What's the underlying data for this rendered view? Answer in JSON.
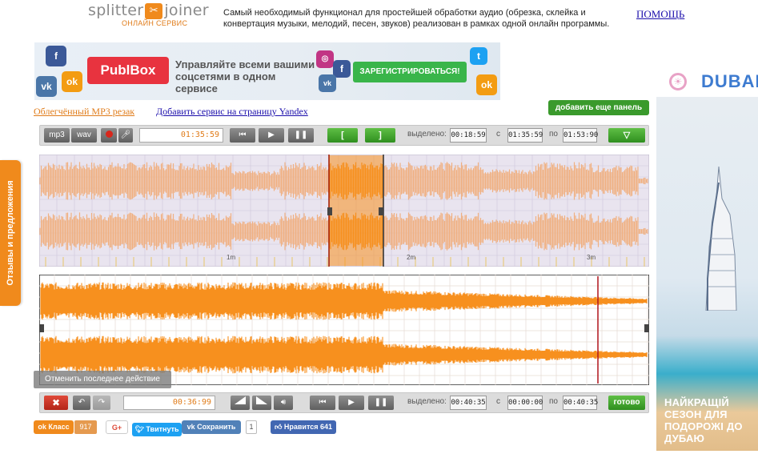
{
  "header": {
    "logo_left": "splitter",
    "logo_right": "joiner",
    "logo_sub": "ОНЛАЙН СЕРВИС",
    "description": "Самый необходимый функционал для простейшей обработки аудио (обрезка, склейка и конвертация музыки, мелодий, песен, звуков) реализован в рамках одной онлайн программы.",
    "help_link": "ПОМОЩЬ"
  },
  "banner": {
    "brand": "PublBox",
    "text": "Управляйте всеми вашими соцсетями в одном сервисе",
    "cta": "ЗАРЕГИСТРИРОВАТЬСЯ!"
  },
  "side_ad": {
    "brand": "DUBAI",
    "text": "НАЙКРАЩІЙ СЕЗОН ДЛЯ ПОДОРОЖІ ДО ДУБАЮ"
  },
  "feedback_tab": "Отзывы и предложения",
  "links": {
    "mp3_cutter": "Облегчённый MP3 резак",
    "add_yandex": "Добавить сервис на страницу Yandex",
    "add_panel": "добавить еще панель"
  },
  "top_toolbar": {
    "fmt_mp3": "mp3",
    "fmt_wav": "wav",
    "time": "01:35:59",
    "bracket_open": "[",
    "bracket_close": "]",
    "selected_label": "выделено:",
    "selected_value": "00:18:59",
    "from_label": "с",
    "from_value": "01:35:59",
    "to_label": "по",
    "to_value": "01:53:90"
  },
  "bottom_toolbar": {
    "time": "00:36:99",
    "selected_label": "выделено:",
    "selected_value": "00:40:35",
    "from_label": "с",
    "from_value": "00:00:00",
    "to_label": "по",
    "to_value": "00:40:35",
    "done": "готово"
  },
  "undo_tooltip": "Отменить последнее действие",
  "waveform_top": {
    "ticks": [
      "1m",
      "2m",
      "3m"
    ]
  },
  "social": {
    "ok_label": "Класс",
    "ok_count": "917",
    "gplus": "G+",
    "tweet": "Твитнуть",
    "vk_save": "Сохранить",
    "vk_count": "1",
    "fb_like": "Нравится 641"
  },
  "colors": {
    "accent_orange": "#f08a1c",
    "button_green": "#3a9a2c",
    "wave_light": "#f0b081",
    "wave_dark": "#f7901e",
    "link_blue": "#1a0dab"
  }
}
